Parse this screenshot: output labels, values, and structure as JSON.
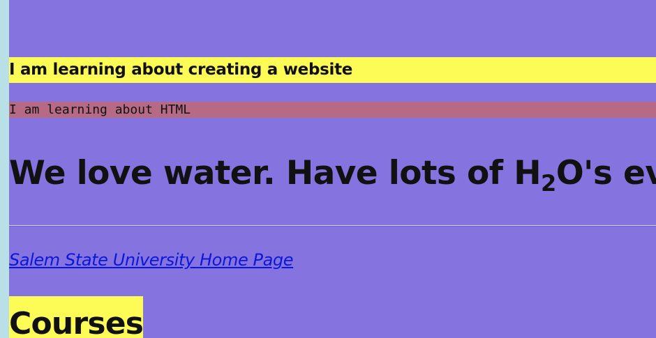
{
  "headings": {
    "website": "I am learning about creating a website",
    "html": "I am learning about HTML"
  },
  "water": {
    "text_before": "We love water. Have lots of H",
    "subscript": "2",
    "text_after": "O's ev"
  },
  "link": {
    "label": "Salem State University Home Page"
  },
  "courses": {
    "title": "Courses"
  },
  "colors": {
    "page_background": "#8574e0",
    "left_strip": "#b9e0e6",
    "yellow_highlight": "#fdfc56",
    "rose_highlight": "#b76a84",
    "link": "#0b17d8"
  }
}
